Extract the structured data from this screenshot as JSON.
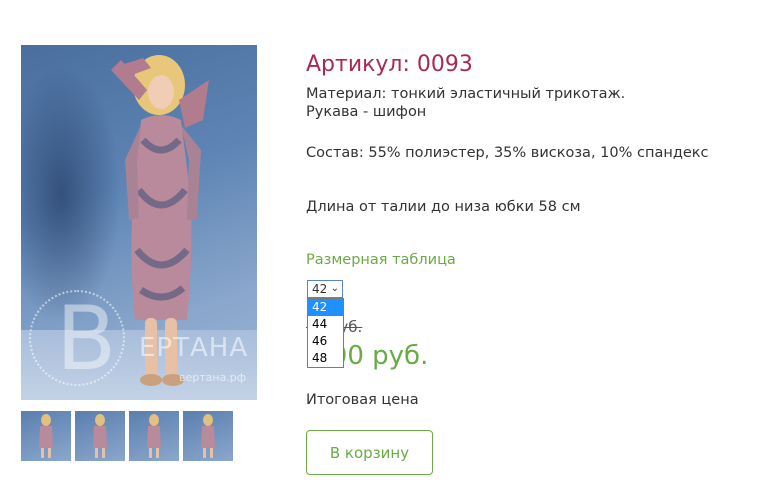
{
  "product": {
    "title": "Артикул: 0093",
    "material_line1": "Материал: тонкий эластичный трикотаж.",
    "material_line2": "Рукава - шифон",
    "composition": "Состав: 55% полиэстер, 35% вискоза, 10% спандекс",
    "length": "Длина от талии до низа юбки 58 см",
    "size_table_link": "Размерная таблица"
  },
  "image": {
    "logo_letter": "В",
    "logo_text": "ЕРТАНА",
    "logo_url": "вертана.рф"
  },
  "size_select": {
    "selected": "42",
    "options": [
      "42",
      "44",
      "46",
      "48"
    ]
  },
  "price": {
    "old_visible": "00 руб.",
    "new_visible": "0,00 руб."
  },
  "total_label": "Итоговая цена",
  "cart_button": "В корзину",
  "colors": {
    "title": "#a72a55",
    "accent_green": "#6aab46",
    "dropdown_highlight": "#1e90ff"
  },
  "icons": {
    "select_arrow": "chevron-down-icon"
  }
}
